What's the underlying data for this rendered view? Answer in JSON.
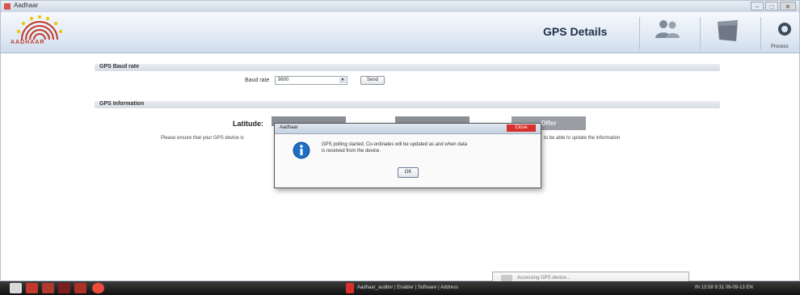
{
  "window": {
    "title": "Aadhaar",
    "controls": [
      "–",
      "□",
      "✕"
    ]
  },
  "header": {
    "logo_text": "AADHAAR",
    "page_title": "GPS Details",
    "icons": [
      "users-icon",
      "document-icon",
      "process-icon"
    ],
    "process_label": "Process"
  },
  "baud_section": {
    "heading": "GPS Baud rate",
    "baud_label": "Baud rate",
    "baud_value": "9600",
    "send_label": "Send"
  },
  "gps_section": {
    "heading": "GPS Information",
    "latitude_label": "Latitude:",
    "gray_button_label": "Offer",
    "notice_left": "Please ensure that your GPS device is",
    "notice_right": "to be able to update the information"
  },
  "dialog": {
    "title": "Aadhaar",
    "close_label": "Close",
    "message_line1": "GPS polling started. Co-ordinates will be updated as and when data",
    "message_line2": "is received from the device.",
    "ok_label": "OK"
  },
  "notification": {
    "text": "Accessing GPS device..."
  },
  "taskbar": {
    "task_label": "Aadhaar_auditor | Enabler | Software | Address",
    "clock": "IN 13:58  9:31 09-09-13  EN"
  },
  "colors": {
    "header_gradient_top": "#f6f9fd",
    "header_gradient_bottom": "#cfdcec",
    "close_red": "#d9302b",
    "info_blue": "#1e6fc4",
    "aadhaar_red": "#c0392b",
    "aadhaar_yellow": "#f1c40f"
  }
}
